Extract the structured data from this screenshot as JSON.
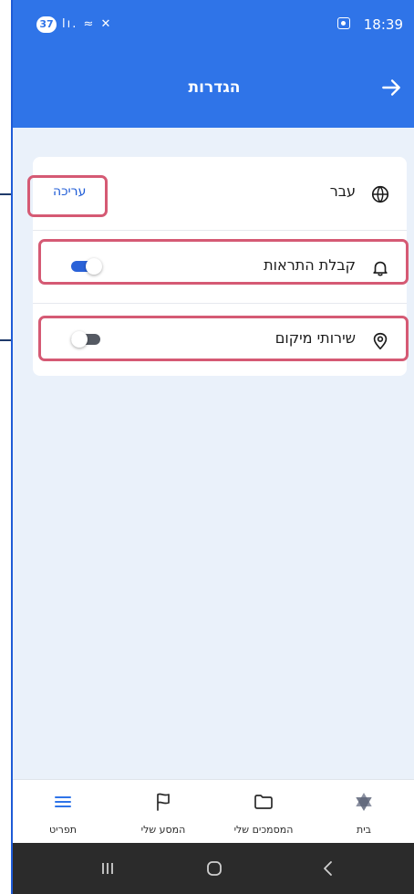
{
  "status_bar": {
    "battery_level": "37",
    "connectivity": "lı. ≈ ✕",
    "time": "18:39"
  },
  "header": {
    "title": "הגדרות"
  },
  "settings": {
    "language": {
      "label": "עבר",
      "action": "עריכה",
      "icon": "globe-icon"
    },
    "notifications": {
      "label": "קבלת התראות",
      "enabled": true,
      "icon": "bell-icon"
    },
    "location": {
      "label": "שירותי מיקום",
      "enabled": false,
      "icon": "location-pin-icon"
    }
  },
  "bottom_nav": {
    "items": [
      {
        "label": "בית",
        "icon": "star-of-david-icon"
      },
      {
        "label": "המסמכים שלי",
        "icon": "folder-icon"
      },
      {
        "label": "המסע שלי",
        "icon": "flag-icon"
      },
      {
        "label": "תפריט",
        "icon": "menu-icon"
      }
    ]
  },
  "colors": {
    "brand_blue": "#2f74e8",
    "highlight": "#d55a74",
    "toggle_on": "#2a62d8"
  }
}
